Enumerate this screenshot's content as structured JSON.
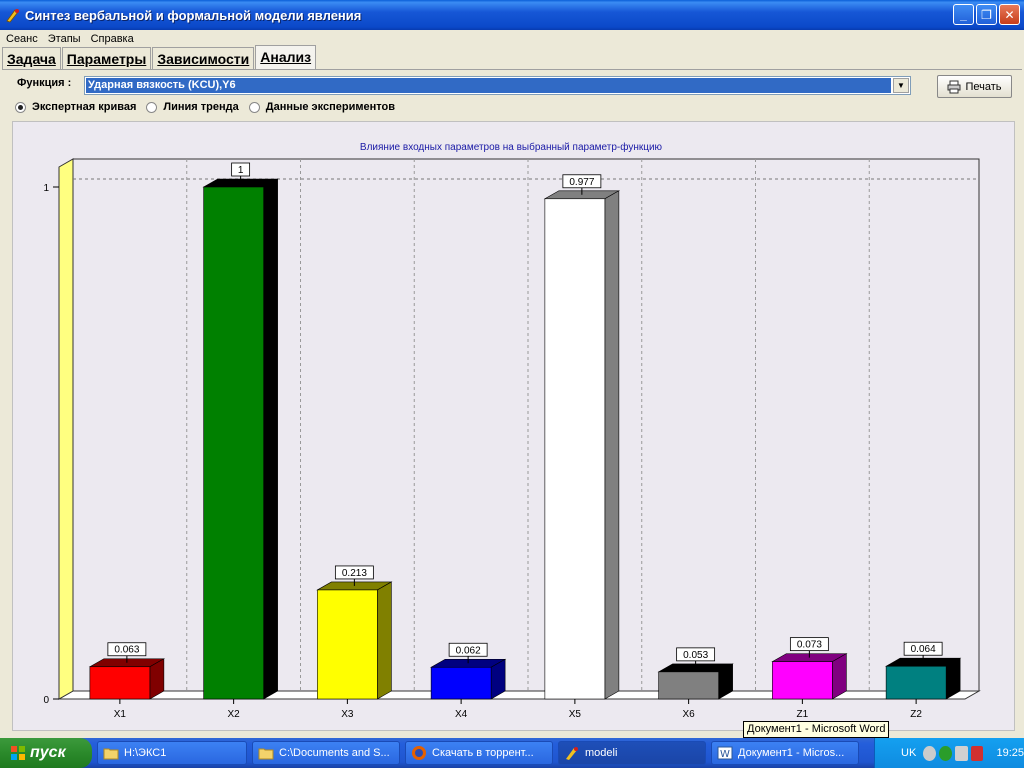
{
  "window": {
    "title": "Синтез вербальной и формальной модели явления",
    "minimize": "_",
    "restore": "❐",
    "close": "✕"
  },
  "menu": [
    "Сеанс",
    "Этапы",
    "Справка"
  ],
  "tabs": [
    {
      "label": "Задача",
      "active": false
    },
    {
      "label": "Параметры",
      "active": false
    },
    {
      "label": "Зависимости",
      "active": false
    },
    {
      "label": "Анализ",
      "active": true
    }
  ],
  "function": {
    "label": "Функция :",
    "value": "Ударная вязкость (KCU),Y6",
    "arrow": "▼"
  },
  "print_button": "Печать",
  "radios": [
    {
      "label": "Экспертная кривая",
      "checked": true
    },
    {
      "label": "Линия тренда",
      "checked": false
    },
    {
      "label": "Данные экспериментов",
      "checked": false
    }
  ],
  "chart_data": {
    "type": "bar",
    "title": "Влияние входных параметров на  выбранный параметр-функцию",
    "categories": [
      "X1",
      "X2",
      "X3",
      "X4",
      "X5",
      "X6",
      "Z1",
      "Z2"
    ],
    "values": [
      0.063,
      1,
      0.213,
      0.062,
      0.977,
      0.053,
      0.073,
      0.064
    ],
    "value_labels": [
      "0.063",
      "1",
      "0.213",
      "0.062",
      "0.977",
      "0.053",
      "0.073",
      "0.064"
    ],
    "colors": [
      "#ff0000",
      "#008000",
      "#ffff00",
      "#0000ff",
      "#ffffff",
      "#808080",
      "#ff00ff",
      "#008080"
    ],
    "side_colors": [
      "#800000",
      "#000000",
      "#808000",
      "#000080",
      "#808080",
      "#000000",
      "#800080",
      "#000000"
    ],
    "ytick_labels": [
      "0",
      "1"
    ],
    "ylim": [
      0,
      1
    ],
    "grid": true
  },
  "tooltip": "Документ1 - Microsoft Word",
  "taskbar": {
    "start_label": "пуск",
    "tasks": [
      {
        "label": "H:\\ЭКС1",
        "icon": "folder-icon",
        "active": false
      },
      {
        "label": "C:\\Documents and S...",
        "icon": "folder-icon",
        "active": false
      },
      {
        "label": "Скачать в торрент...",
        "icon": "firefox-icon",
        "active": false
      },
      {
        "label": "modeli",
        "icon": "app-icon",
        "active": true
      },
      {
        "label": "Документ1 - Micros...",
        "icon": "word-icon",
        "active": false
      }
    ],
    "lang": "UK",
    "clock": "19:25"
  }
}
